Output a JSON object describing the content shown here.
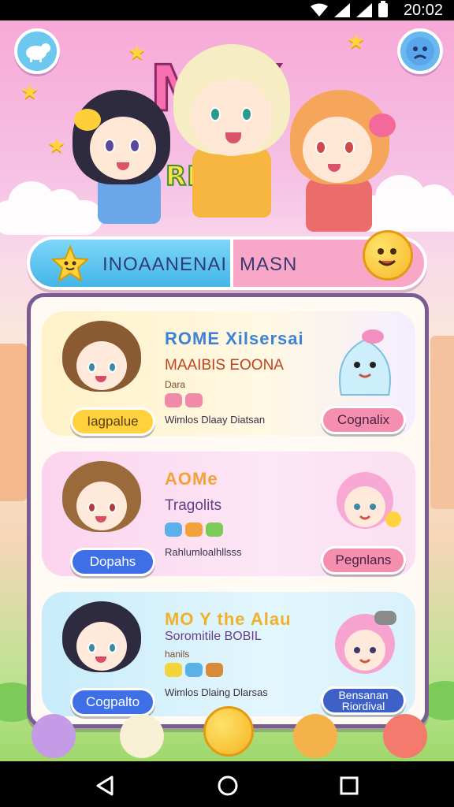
{
  "status_bar": {
    "time": "20:02"
  },
  "header": {
    "logo_big": "M  Y",
    "logo_sub": "RKA"
  },
  "tabs": [
    {
      "label": "INOAANENAI",
      "active": true
    },
    {
      "label": "MASN",
      "active": false
    }
  ],
  "cards": [
    {
      "title": "ROME Xilsersai",
      "subtitle": "MAAIBIS EOONA",
      "tiny": "Dara",
      "description": "Wimlos Dlaay Diatsan",
      "left_button": "Iagpalue",
      "right_button": "Cognalix",
      "accent": "#ffd13b"
    },
    {
      "title": "AOMe",
      "subtitle": "Tragolits",
      "tiny": "",
      "description": "Rahlumloalhllsss",
      "left_button": "Dopahs",
      "right_button": "Pegnlans",
      "accent": "#3f6fe6"
    },
    {
      "title": "MO Y the Alau",
      "subtitle": "Soromitile BOBIL",
      "tiny": "hanils",
      "description": "Wimlos Dlaing Dlarsas",
      "left_button": "Cogpalto",
      "right_button": "Bensanan Riordival",
      "accent": "#3e61c7"
    }
  ],
  "colors": {
    "tab_active": "#43b6e8",
    "tab_inactive": "#f8a7c9",
    "panel_border": "#7a5c93"
  }
}
